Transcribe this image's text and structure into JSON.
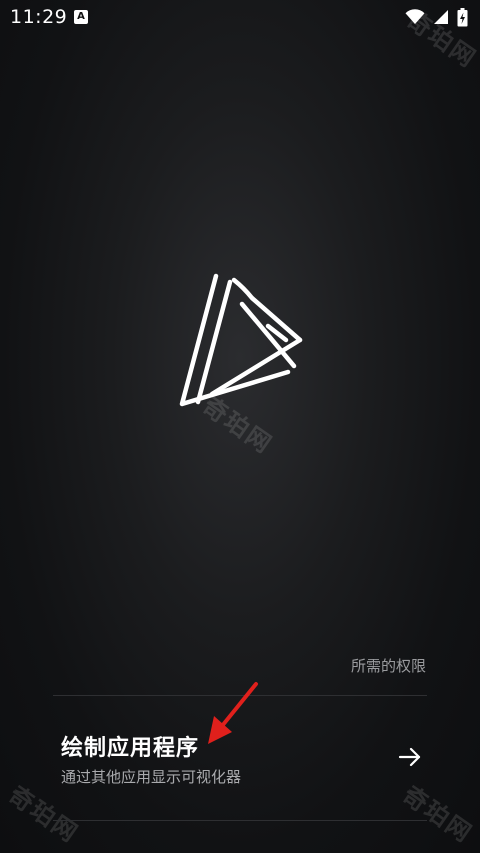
{
  "status_bar": {
    "time": "11:29",
    "notification_icon": "a-icon",
    "wifi_icon": "wifi-icon",
    "signal_icon": "signal-icon",
    "battery_icon": "battery-charging-icon"
  },
  "watermark": {
    "text": "奇珀网"
  },
  "logo": {
    "icon": "play-triangle-logo-icon"
  },
  "permissions": {
    "section_title": "所需的权限",
    "items": [
      {
        "name": "绘制应用程序",
        "description": "通过其他应用显示可视化器",
        "action_icon": "arrow-right-icon"
      }
    ]
  },
  "annotation": {
    "icon": "red-arrow-annotation",
    "color": "#e0201c"
  },
  "colors": {
    "background": "#111214",
    "primary_text": "#ffffff",
    "secondary_text": "#a9aaad"
  }
}
